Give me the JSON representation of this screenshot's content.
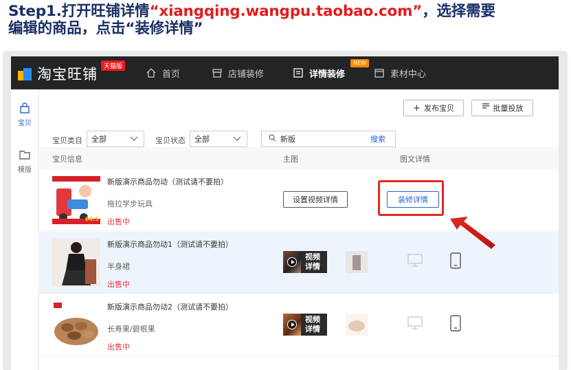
{
  "headline": {
    "prefix": "Step1.打开旺铺详情",
    "url": "“xiangqing.wangpu.taobao.com”",
    "suffix": "，选择需要",
    "line2": "编辑的商品，点击“装修详情”"
  },
  "app": {
    "logo_text": "淘宝旺铺",
    "tmall_tag": "天猫版",
    "new_tag": "NEW",
    "nav": [
      {
        "label": "首页",
        "icon": "home-icon"
      },
      {
        "label": "店铺装修",
        "icon": "shop-icon"
      },
      {
        "label": "详情装修",
        "icon": "detail-icon"
      },
      {
        "label": "素材中心",
        "icon": "folder-icon"
      }
    ]
  },
  "sidebar": {
    "items": [
      {
        "label": "宝贝",
        "icon": "bag-icon"
      },
      {
        "label": "模版",
        "icon": "template-folder-icon"
      }
    ]
  },
  "toolbar": {
    "publish_label": "发布宝贝",
    "batch_label": "批量投放"
  },
  "filters": {
    "category_label": "宝贝类目",
    "category_value": "全部",
    "status_label": "宝贝状态",
    "status_value": "全部",
    "search_value": "新版",
    "search_button": "搜索"
  },
  "table": {
    "headers": [
      "宝贝信息",
      "主图",
      "图文详情"
    ],
    "rows": [
      {
        "title": "新版演示商品勿动（测试请不要拍）",
        "subtitle": "拖拉学步玩具",
        "status": "出售中",
        "video_button": "设置视频详情",
        "decorate_button": "装修详情",
        "price_tag": "64.5"
      },
      {
        "title": "新版演示商品勿动1（测试请不要拍）",
        "subtitle": "半身裙",
        "status": "出售中",
        "video_label_1": "视频",
        "video_label_2": "详情"
      },
      {
        "title": "新版演示商品勿动2（测试请不要拍）",
        "subtitle": "长寿果/碧根果",
        "status": "出售中",
        "video_label_1": "视频",
        "video_label_2": "详情"
      }
    ]
  },
  "colors": {
    "accent_blue": "#2962d9",
    "highlight_red": "#e12a23",
    "topbar": "#222427",
    "headline": "#1a2f66"
  }
}
